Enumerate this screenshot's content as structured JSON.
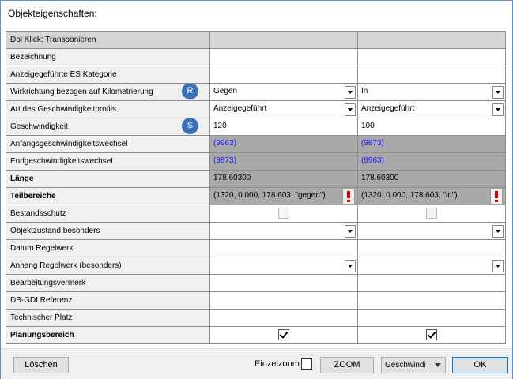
{
  "window": {
    "title": "Objekteigenschaften:"
  },
  "rows": {
    "r0": {
      "label": "Dbl Klick: Transponieren"
    },
    "r1": {
      "label": "Bezeichnung"
    },
    "r2": {
      "label": "Anzeigegeführte ES Kategorie"
    },
    "r3": {
      "label": "Wirkrichtung bezogen auf Kilometrierung",
      "badge": "R",
      "v1": "Gegen",
      "v2": "In"
    },
    "r4": {
      "label": "Art des Geschwindigkeitprofils",
      "v1": "Anzeigegeführt",
      "v2": "Anzeigegeführt"
    },
    "r5": {
      "label": "Geschwindigkeit",
      "badge": "S",
      "v1": "120",
      "v2": "100"
    },
    "r6": {
      "label": "Anfangsgeschwindigkeitswechsel",
      "v1": "(9963)",
      "v2": "(9873)"
    },
    "r7": {
      "label": "Endgeschwindigkeitswechsel",
      "v1": "(9873)",
      "v2": "(9963)"
    },
    "r8": {
      "label": "Länge",
      "v1": "178.60300",
      "v2": "178.60300"
    },
    "r9": {
      "label": "Teilbereiche",
      "v1": "(1320, 0.000, 178.603, \"gegen\")",
      "v2": "(1320, 0.000, 178.603, \"in\")"
    },
    "r10": {
      "label": "Bestandsschutz",
      "v1_checked": false,
      "v2_checked": false
    },
    "r11": {
      "label": "Objektzustand besonders"
    },
    "r12": {
      "label": "Datum Regelwerk"
    },
    "r13": {
      "label": "Anhang Regelwerk (besonders)"
    },
    "r14": {
      "label": "Bearbeitungsvermerk"
    },
    "r15": {
      "label": "DB-GDI Referenz"
    },
    "r16": {
      "label": "Technischer Platz"
    },
    "r17": {
      "label": "Planungsbereich",
      "v1_checked": true,
      "v2_checked": true
    }
  },
  "footer": {
    "delete_label": "Löschen",
    "einzelzoom_label": "Einzelzoom",
    "einzelzoom_checked": false,
    "zoom_label": "ZOOM",
    "select_value": "Geschwindi",
    "ok_label": "OK"
  },
  "colors": {
    "badge": "#3d6fb6",
    "link": "#1a1aff",
    "gray_cell": "#a9a9a9",
    "warn": "#dd0000"
  }
}
